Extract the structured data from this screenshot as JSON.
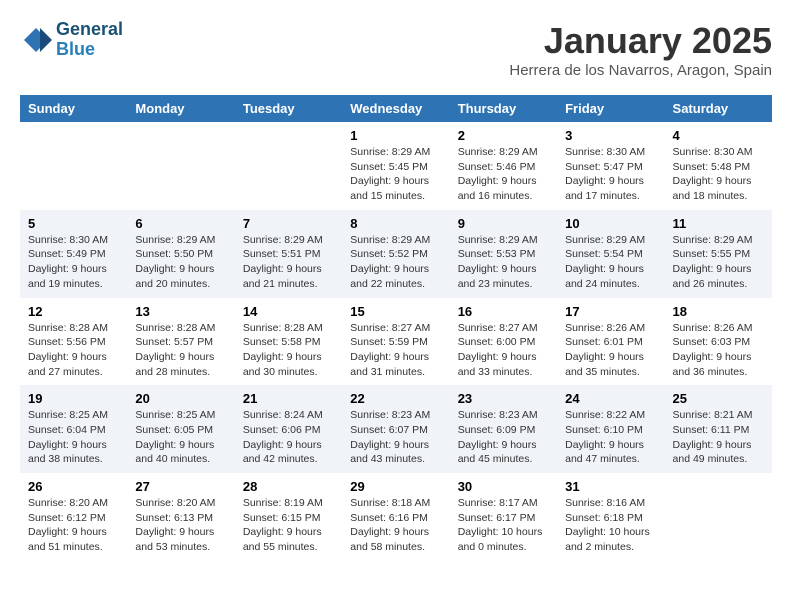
{
  "header": {
    "logo_line1": "General",
    "logo_line2": "Blue",
    "month_title": "January 2025",
    "subtitle": "Herrera de los Navarros, Aragon, Spain"
  },
  "weekdays": [
    "Sunday",
    "Monday",
    "Tuesday",
    "Wednesday",
    "Thursday",
    "Friday",
    "Saturday"
  ],
  "weeks": [
    [
      {
        "day": "",
        "info": ""
      },
      {
        "day": "",
        "info": ""
      },
      {
        "day": "",
        "info": ""
      },
      {
        "day": "1",
        "info": "Sunrise: 8:29 AM\nSunset: 5:45 PM\nDaylight: 9 hours\nand 15 minutes."
      },
      {
        "day": "2",
        "info": "Sunrise: 8:29 AM\nSunset: 5:46 PM\nDaylight: 9 hours\nand 16 minutes."
      },
      {
        "day": "3",
        "info": "Sunrise: 8:30 AM\nSunset: 5:47 PM\nDaylight: 9 hours\nand 17 minutes."
      },
      {
        "day": "4",
        "info": "Sunrise: 8:30 AM\nSunset: 5:48 PM\nDaylight: 9 hours\nand 18 minutes."
      }
    ],
    [
      {
        "day": "5",
        "info": "Sunrise: 8:30 AM\nSunset: 5:49 PM\nDaylight: 9 hours\nand 19 minutes."
      },
      {
        "day": "6",
        "info": "Sunrise: 8:29 AM\nSunset: 5:50 PM\nDaylight: 9 hours\nand 20 minutes."
      },
      {
        "day": "7",
        "info": "Sunrise: 8:29 AM\nSunset: 5:51 PM\nDaylight: 9 hours\nand 21 minutes."
      },
      {
        "day": "8",
        "info": "Sunrise: 8:29 AM\nSunset: 5:52 PM\nDaylight: 9 hours\nand 22 minutes."
      },
      {
        "day": "9",
        "info": "Sunrise: 8:29 AM\nSunset: 5:53 PM\nDaylight: 9 hours\nand 23 minutes."
      },
      {
        "day": "10",
        "info": "Sunrise: 8:29 AM\nSunset: 5:54 PM\nDaylight: 9 hours\nand 24 minutes."
      },
      {
        "day": "11",
        "info": "Sunrise: 8:29 AM\nSunset: 5:55 PM\nDaylight: 9 hours\nand 26 minutes."
      }
    ],
    [
      {
        "day": "12",
        "info": "Sunrise: 8:28 AM\nSunset: 5:56 PM\nDaylight: 9 hours\nand 27 minutes."
      },
      {
        "day": "13",
        "info": "Sunrise: 8:28 AM\nSunset: 5:57 PM\nDaylight: 9 hours\nand 28 minutes."
      },
      {
        "day": "14",
        "info": "Sunrise: 8:28 AM\nSunset: 5:58 PM\nDaylight: 9 hours\nand 30 minutes."
      },
      {
        "day": "15",
        "info": "Sunrise: 8:27 AM\nSunset: 5:59 PM\nDaylight: 9 hours\nand 31 minutes."
      },
      {
        "day": "16",
        "info": "Sunrise: 8:27 AM\nSunset: 6:00 PM\nDaylight: 9 hours\nand 33 minutes."
      },
      {
        "day": "17",
        "info": "Sunrise: 8:26 AM\nSunset: 6:01 PM\nDaylight: 9 hours\nand 35 minutes."
      },
      {
        "day": "18",
        "info": "Sunrise: 8:26 AM\nSunset: 6:03 PM\nDaylight: 9 hours\nand 36 minutes."
      }
    ],
    [
      {
        "day": "19",
        "info": "Sunrise: 8:25 AM\nSunset: 6:04 PM\nDaylight: 9 hours\nand 38 minutes."
      },
      {
        "day": "20",
        "info": "Sunrise: 8:25 AM\nSunset: 6:05 PM\nDaylight: 9 hours\nand 40 minutes."
      },
      {
        "day": "21",
        "info": "Sunrise: 8:24 AM\nSunset: 6:06 PM\nDaylight: 9 hours\nand 42 minutes."
      },
      {
        "day": "22",
        "info": "Sunrise: 8:23 AM\nSunset: 6:07 PM\nDaylight: 9 hours\nand 43 minutes."
      },
      {
        "day": "23",
        "info": "Sunrise: 8:23 AM\nSunset: 6:09 PM\nDaylight: 9 hours\nand 45 minutes."
      },
      {
        "day": "24",
        "info": "Sunrise: 8:22 AM\nSunset: 6:10 PM\nDaylight: 9 hours\nand 47 minutes."
      },
      {
        "day": "25",
        "info": "Sunrise: 8:21 AM\nSunset: 6:11 PM\nDaylight: 9 hours\nand 49 minutes."
      }
    ],
    [
      {
        "day": "26",
        "info": "Sunrise: 8:20 AM\nSunset: 6:12 PM\nDaylight: 9 hours\nand 51 minutes."
      },
      {
        "day": "27",
        "info": "Sunrise: 8:20 AM\nSunset: 6:13 PM\nDaylight: 9 hours\nand 53 minutes."
      },
      {
        "day": "28",
        "info": "Sunrise: 8:19 AM\nSunset: 6:15 PM\nDaylight: 9 hours\nand 55 minutes."
      },
      {
        "day": "29",
        "info": "Sunrise: 8:18 AM\nSunset: 6:16 PM\nDaylight: 9 hours\nand 58 minutes."
      },
      {
        "day": "30",
        "info": "Sunrise: 8:17 AM\nSunset: 6:17 PM\nDaylight: 10 hours\nand 0 minutes."
      },
      {
        "day": "31",
        "info": "Sunrise: 8:16 AM\nSunset: 6:18 PM\nDaylight: 10 hours\nand 2 minutes."
      },
      {
        "day": "",
        "info": ""
      }
    ]
  ]
}
